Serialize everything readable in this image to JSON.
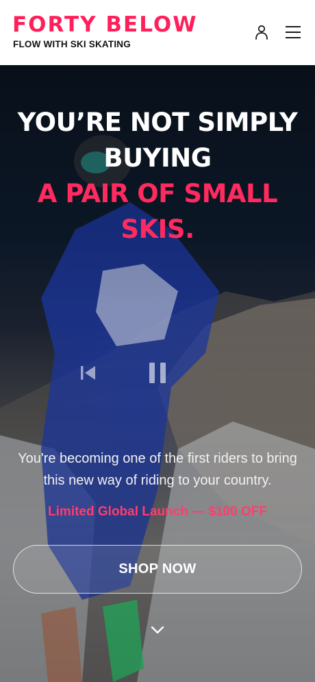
{
  "header": {
    "logo_text": "FORTY BELOW",
    "tagline": "FLOW WITH SKI SKATING",
    "icons": [
      "user-icon",
      "menu-icon"
    ]
  },
  "hero": {
    "headline_line1": "YOU’RE NOT SIMPLY",
    "headline_line2": "BUYING",
    "headline_line3": "A PAIR OF SMALL",
    "headline_line4": "SKIS.",
    "controls": [
      "previous-icon",
      "pause-icon"
    ],
    "body_text": "You're becoming one of the first riders to bring this new way of riding to your country.",
    "promo_text": "Limited Global Launch — $100 OFF",
    "cta_label": "SHOP NOW",
    "scroll_icon": "chevron-down-icon"
  },
  "colors": {
    "brand_pink": "#ff1f5a",
    "text_dark": "#111111",
    "promo_pink": "#ff3d6e"
  }
}
